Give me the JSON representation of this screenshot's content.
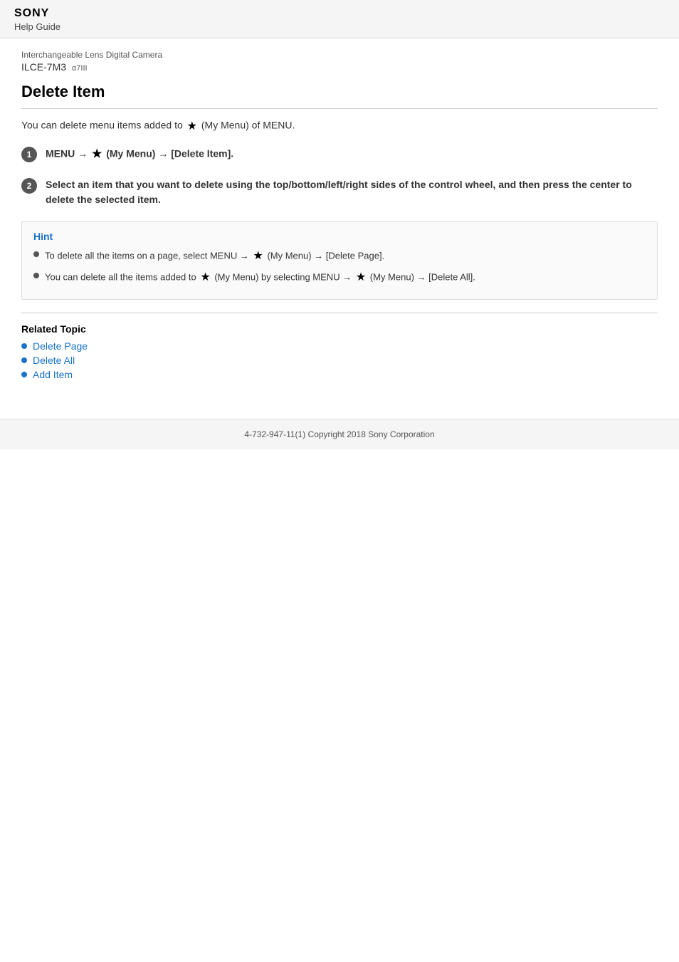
{
  "header": {
    "brand": "SONY",
    "help_guide": "Help Guide"
  },
  "breadcrumb": {
    "line1": "Interchangeable Lens Digital Camera",
    "line2": "ILCE-7M3",
    "line2_sub": "α7III"
  },
  "page": {
    "title": "Delete Item",
    "intro": "You can delete menu items added to",
    "intro_suffix": "(My Menu) of MENU.",
    "step1_prefix": "MENU → ",
    "step1_middle": " (My Menu) → [Delete Item].",
    "step2": "Select an item that you want to delete using the top/bottom/left/right sides of the control wheel, and then press the center to delete the selected item."
  },
  "hint": {
    "title": "Hint",
    "items": [
      {
        "text_prefix": "To delete all the items on a page, select MENU → ",
        "text_middle": " (My Menu) → [Delete Page].",
        "text_suffix": ""
      },
      {
        "text_prefix": "You can delete all the items added to ",
        "text_middle": " (My Menu) by selecting MENU → ",
        "text_middle2": " (My Menu) → [Delete All].",
        "text_suffix": ""
      }
    ]
  },
  "related": {
    "title": "Related Topic",
    "links": [
      {
        "label": "Delete Page"
      },
      {
        "label": "Delete All"
      },
      {
        "label": "Add Item"
      }
    ]
  },
  "footer": {
    "copyright": "4-732-947-11(1) Copyright 2018 Sony Corporation"
  }
}
